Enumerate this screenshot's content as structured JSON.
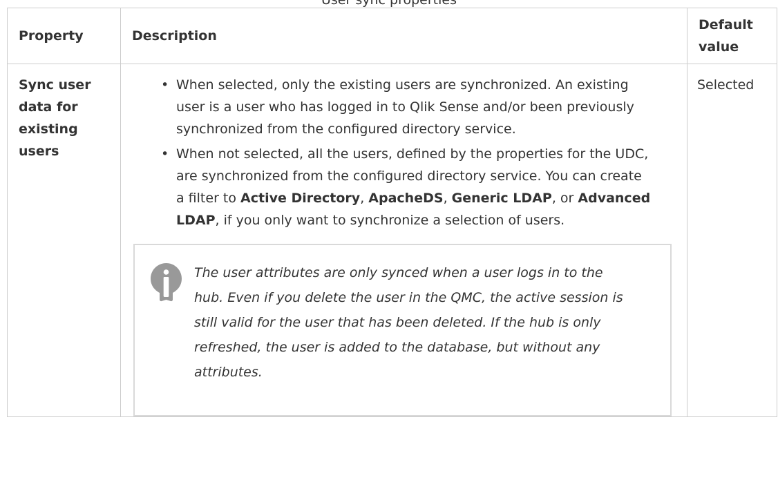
{
  "caption": "User sync properties",
  "table": {
    "headers": [
      "Property",
      "Description",
      "Default value"
    ],
    "row": {
      "property": "Sync user data for existing users",
      "bullet1": "When selected, only the existing users are synchronized. An existing user is a user who has logged in to Qlik Sense and/or been previously synchronized from the configured directory service.",
      "bullet2": {
        "part1": "When not selected, all the users, defined by the properties for the UDC, are synchronized from the configured directory service. You can create a filter to ",
        "link1": "Active Directory",
        "sep1": ", ",
        "link2": "ApacheDS",
        "sep2": ", ",
        "link3": "Generic LDAP",
        "sep3": ", or ",
        "link4": "Advanced LDAP",
        "part2": ", if you only want to synchronize a selection of users."
      },
      "note": "The user attributes are only synced when a user logs in to the hub. Even if you delete the user in the QMC, the active session is still valid for the user that has been deleted. If the hub is only refreshed, the user is added to the database, but without any attributes.",
      "default_value": "Selected"
    }
  },
  "colors": {
    "border": "#cccccc",
    "note_border": "#d9d9d9",
    "icon": "#999999",
    "text": "#333333"
  },
  "icons": {
    "note": "info-icon"
  }
}
